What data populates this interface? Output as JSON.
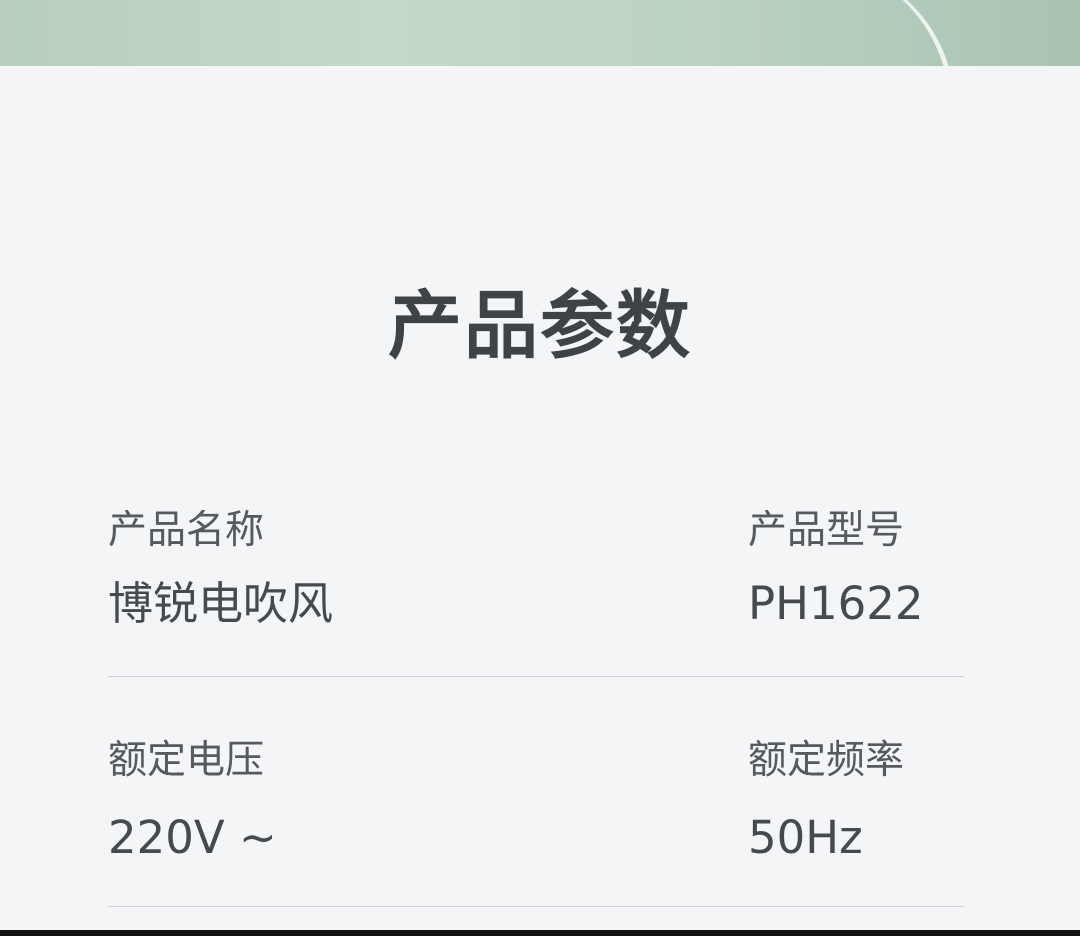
{
  "section": {
    "title": "产品参数"
  },
  "specs": [
    {
      "left": {
        "label": "产品名称",
        "value": "博锐电吹风"
      },
      "right": {
        "label": "产品型号",
        "value": "PH1622"
      }
    },
    {
      "left": {
        "label": "额定电压",
        "value": "220V ~"
      },
      "right": {
        "label": "额定频率",
        "value": "50Hz"
      }
    }
  ],
  "colors": {
    "banner": "#bcd3c3",
    "background": "#f4f5f7",
    "title_text": "#3f4246",
    "body_text": "#46494d",
    "divider": "#cfd1d4"
  }
}
